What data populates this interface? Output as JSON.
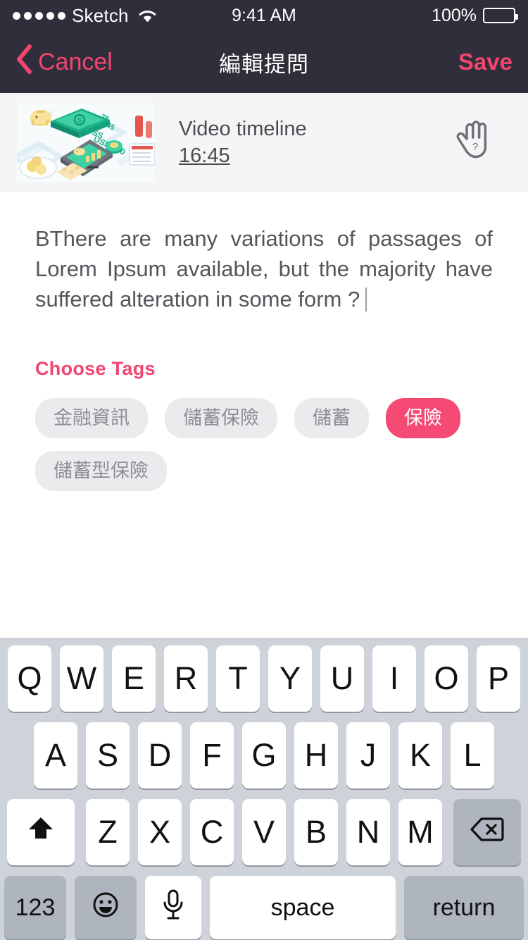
{
  "status_bar": {
    "carrier": "Sketch",
    "signal_dots": 5,
    "wifi_icon": "wifi-icon",
    "time": "9:41 AM",
    "battery_percent": "100%",
    "battery_level": 100
  },
  "nav_bar": {
    "back_icon": "chevron-left-icon",
    "cancel_label": "Cancel",
    "title": "編輯提問",
    "save_label": "Save",
    "background_color": "#302E3A",
    "accent_color": "#F2456F"
  },
  "video_row": {
    "thumbnail_icon": "finance-illustration-thumbnail",
    "title": "Video timeline",
    "timestamp": "16:45",
    "help_icon": "hand-question-icon"
  },
  "question": {
    "text": "BThere are many variations of passages of Lorem Ipsum available, but the majority have suffered alteration in some form ?",
    "caret_visible": true
  },
  "tags": {
    "heading": "Choose Tags",
    "heading_color": "#F2456F",
    "selected_background": "#F54A74",
    "unselected_background": "#EBEBEE",
    "items": [
      {
        "label": "金融資訊",
        "selected": false
      },
      {
        "label": "儲蓄保險",
        "selected": false
      },
      {
        "label": "儲蓄",
        "selected": false
      },
      {
        "label": "保險",
        "selected": true
      },
      {
        "label": "儲蓄型保險",
        "selected": false
      }
    ]
  },
  "keyboard": {
    "background_color": "#CED2D9",
    "row1": [
      "Q",
      "W",
      "E",
      "R",
      "T",
      "Y",
      "U",
      "I",
      "O",
      "P"
    ],
    "row2": [
      "A",
      "S",
      "D",
      "F",
      "G",
      "H",
      "J",
      "K",
      "L"
    ],
    "row3_letters": [
      "Z",
      "X",
      "C",
      "V",
      "B",
      "N",
      "M"
    ],
    "shift_icon": "shift-arrow-icon",
    "backspace_icon": "backspace-delete-icon",
    "numbers_label": "123",
    "emoji_icon": "emoji-smiley-icon",
    "mic_icon": "microphone-icon",
    "space_label": "space",
    "return_label": "return"
  }
}
